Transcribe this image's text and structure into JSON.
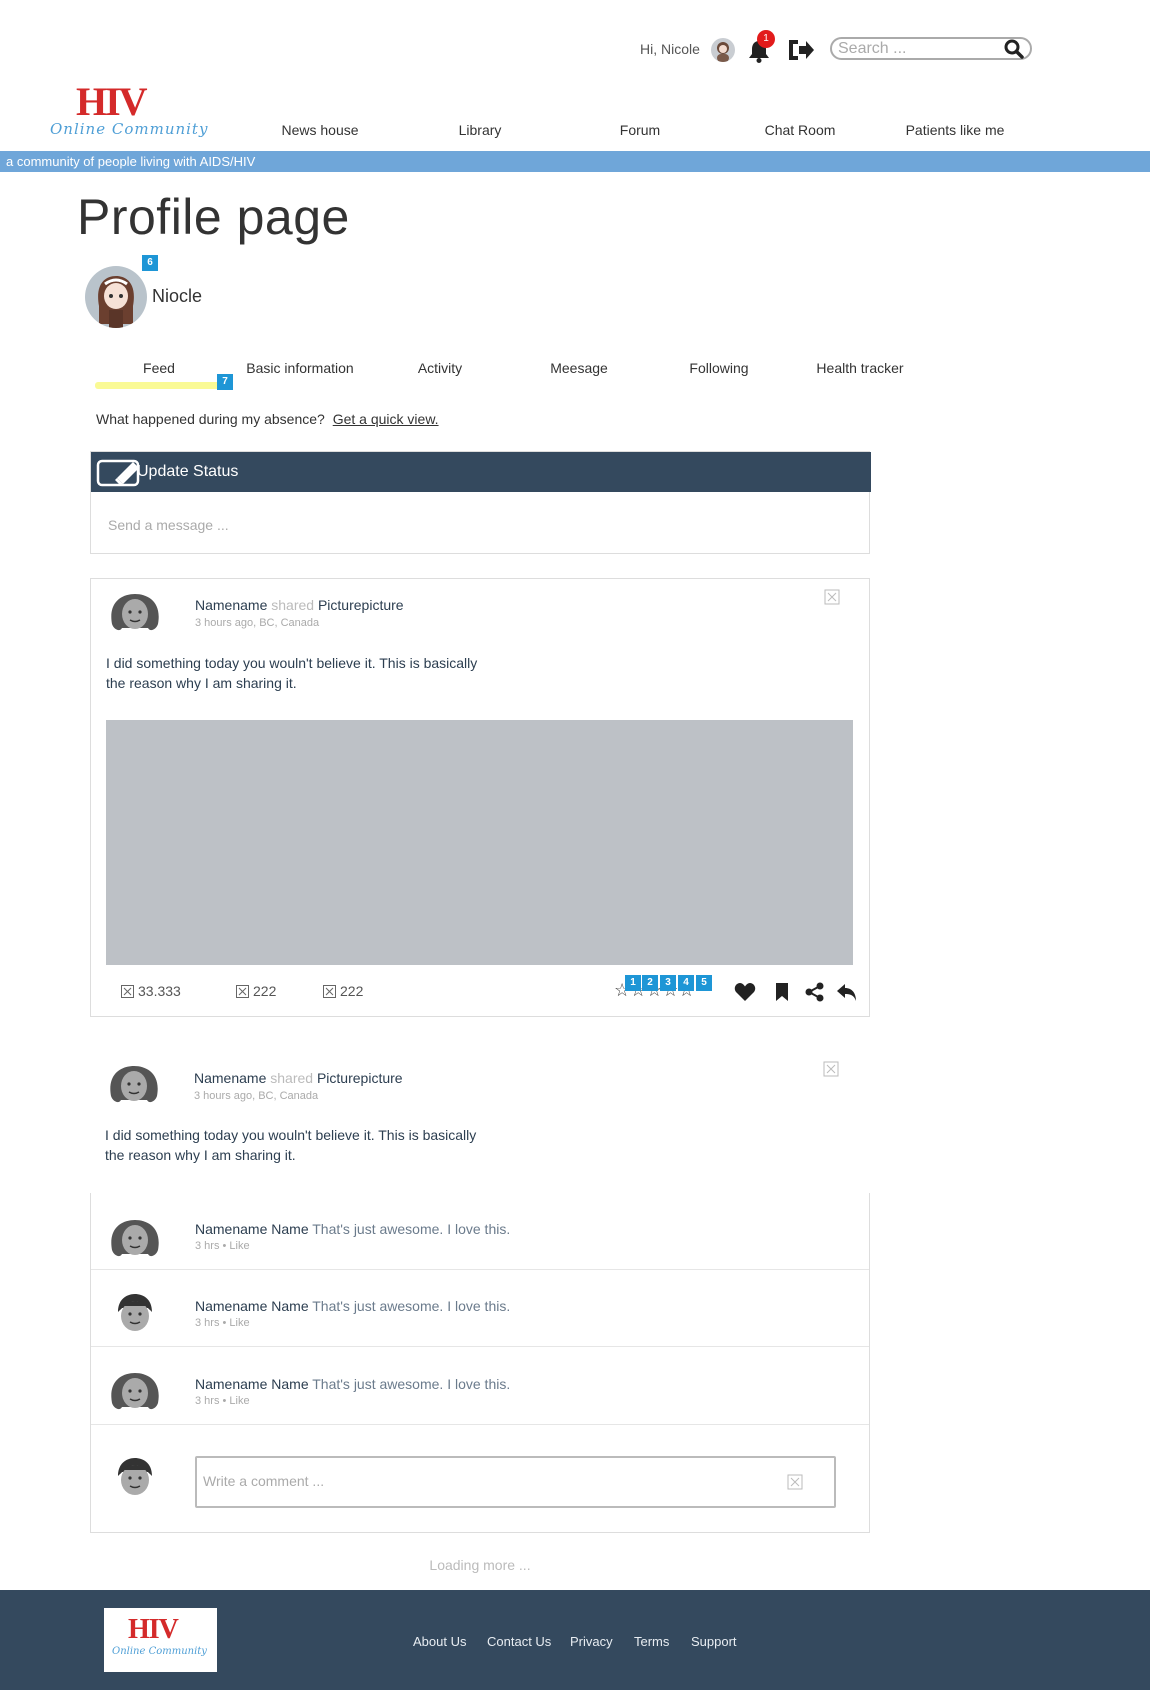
{
  "header": {
    "greeting": "Hi, Nicole",
    "notification_count": "1",
    "search_placeholder": "Search ..."
  },
  "logo": {
    "mark": "HIV",
    "subtitle": "Online Community"
  },
  "nav": {
    "items": [
      "News house",
      "Library",
      "Forum",
      "Chat Room",
      "Patients like me"
    ]
  },
  "tagline": "a community of people living with AIDS/HIV",
  "page_title": "Profile page",
  "profile": {
    "name": "Niocle",
    "badge": "6"
  },
  "tabs": {
    "items": [
      "Feed",
      "Basic information",
      "Activity",
      "Meesage",
      "Following",
      "Health tracker"
    ],
    "badge": "7"
  },
  "quick_view": {
    "question": "What happened during my absence?",
    "link": "Get a quick view."
  },
  "status": {
    "title": "Update Status",
    "placeholder": "Send a message ..."
  },
  "post1": {
    "author": "Namename",
    "verb": "shared",
    "object": "Picturepicture",
    "meta": "3 hours ago, BC, Canada",
    "text": "I did something today you wouln't believe it. This is basically the reason why I am sharing it.",
    "stats": [
      "33.333",
      "222",
      "222"
    ],
    "stars": "☆☆☆☆☆",
    "rating_badges": [
      "1",
      "2",
      "3",
      "4",
      "5"
    ]
  },
  "post2": {
    "author": "Namename",
    "verb": "shared",
    "object": "Picturepicture",
    "meta": "3 hours ago, BC, Canada",
    "text": "I did something today you wouln't believe it. This is basically the reason why I am sharing it."
  },
  "comments": [
    {
      "author": "Namename Name",
      "text": "That's just awesome. I love this.",
      "meta": "3 hrs • Like"
    },
    {
      "author": "Namename Name",
      "text": "That's just awesome. I love this.",
      "meta": "3 hrs • Like"
    },
    {
      "author": "Namename Name",
      "text": "That's just awesome. I love this.",
      "meta": "3 hrs • Like"
    }
  ],
  "comment_placeholder": "Write a comment ...",
  "loading": "Loading more ...",
  "footer": {
    "links": [
      "About Us",
      "Contact Us",
      "Privacy",
      "Terms",
      "Support"
    ]
  },
  "colors": {
    "accent_bar": "#6fa6d9",
    "dark_header": "#34495e",
    "badge_blue": "#1e96d6",
    "notification_red": "#e21b1b",
    "logo_red": "#d42a2a",
    "tab_underline": "#fafa95"
  },
  "icons": [
    "avatar",
    "bell-icon",
    "logout-icon",
    "search-icon",
    "edit-icon",
    "broken-image-icon",
    "heart-icon",
    "bookmark-icon",
    "share-icon",
    "reply-icon",
    "star-icon"
  ]
}
